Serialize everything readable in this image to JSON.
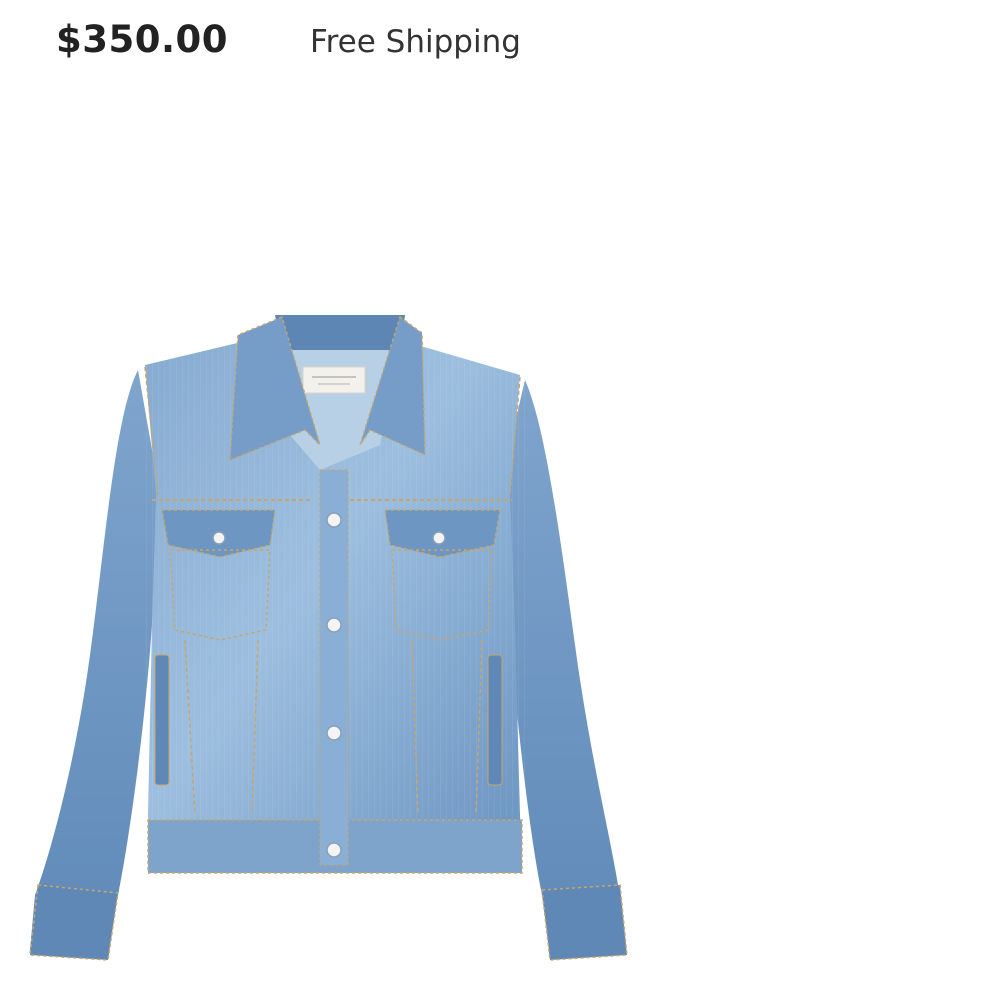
{
  "product": {
    "price": "$350.00",
    "shipping": "Free Shipping",
    "colors": {
      "denim_light": "#8fb3d6",
      "denim_mid": "#6f98c4",
      "denim_dark": "#4d76a6",
      "stitch": "#c9a56a",
      "button": "#f4f4f4"
    }
  }
}
